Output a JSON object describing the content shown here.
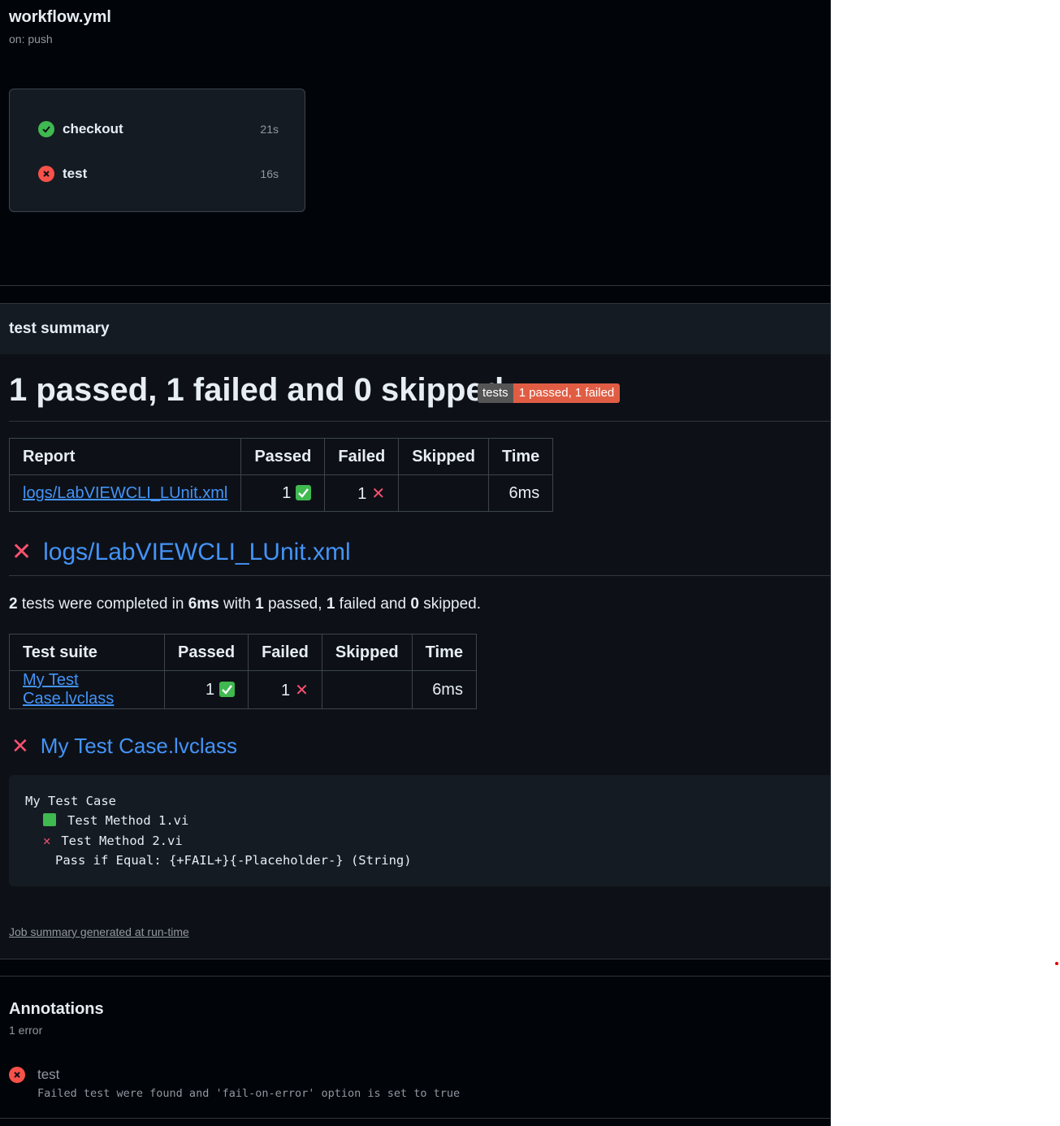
{
  "workflow": {
    "file": "workflow.yml",
    "trigger": "on: push"
  },
  "jobs": [
    {
      "name": "checkout",
      "status": "success",
      "duration": "21s"
    },
    {
      "name": "test",
      "status": "failure",
      "duration": "16s"
    }
  ],
  "summary": {
    "header": "test summary",
    "heading": "1 passed, 1 failed and 0 skipped",
    "badge": {
      "label": "tests",
      "value": "1 passed, 1 failed"
    },
    "report_table": {
      "headers": [
        "Report",
        "Passed",
        "Failed",
        "Skipped",
        "Time"
      ],
      "row": {
        "report": "logs/LabVIEWCLI_LUnit.xml",
        "passed": "1",
        "failed": "1",
        "skipped": "",
        "time": "6ms"
      }
    },
    "report_heading": "logs/LabVIEWCLI_LUnit.xml",
    "completion": {
      "tests": "2",
      "t1": " tests were completed in ",
      "duration": "6ms",
      "t2": " with ",
      "passed": "1",
      "t3": " passed, ",
      "failed": "1",
      "t4": " failed and ",
      "skipped": "0",
      "t5": " skipped."
    },
    "suite_table": {
      "headers": [
        "Test suite",
        "Passed",
        "Failed",
        "Skipped",
        "Time"
      ],
      "row": {
        "suite": "My Test Case.lvclass",
        "passed": "1",
        "failed": "1",
        "skipped": "",
        "time": "6ms"
      }
    },
    "suite_heading": "My Test Case.lvclass",
    "code": {
      "title": "My Test Case",
      "method1": "Test Method 1.vi",
      "method2": "Test Method 2.vi",
      "detail": "Pass if Equal: {+FAIL+}{-Placeholder-} (String)"
    },
    "footer": "Job summary generated at run-time"
  },
  "annotations": {
    "title": "Annotations",
    "count": "1 error",
    "items": [
      {
        "name": "test",
        "message": "Failed test were found and 'fail-on-error' option is set to true"
      }
    ]
  },
  "colors": {
    "success": "#3fb950",
    "failure": "#f85149",
    "link": "#4493f8",
    "badge_fail": "#e05d44"
  }
}
